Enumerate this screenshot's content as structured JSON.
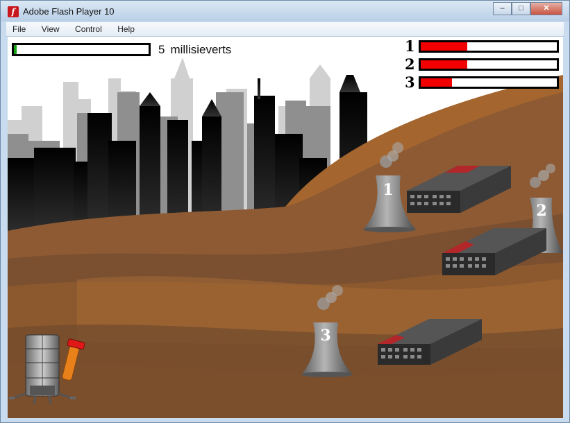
{
  "window": {
    "title": "Adobe Flash Player 10",
    "minimize_glyph": "–",
    "maximize_glyph": "□",
    "close_glyph": "✕"
  },
  "menu": [
    "File",
    "View",
    "Control",
    "Help"
  ],
  "hud": {
    "radiation_value": "5",
    "radiation_unit": "millisieverts",
    "radiation_fill_fraction": 0.02,
    "radiation_fill_color": "#15a315",
    "plants": [
      {
        "label": "1",
        "health_fraction": 0.34
      },
      {
        "label": "2",
        "health_fraction": 0.34
      },
      {
        "label": "3",
        "health_fraction": 0.23
      }
    ],
    "plant_bar_color": "#f20000"
  },
  "scene": {
    "towers": [
      {
        "label": "1"
      },
      {
        "label": "2"
      },
      {
        "label": "3"
      }
    ],
    "buildings_count_visible": 3,
    "ground_color": "#7a5030",
    "skyline_color": "#1a1a1a"
  },
  "icons": {
    "app": "flash-icon",
    "player_unit": "water-cannon-icon"
  }
}
